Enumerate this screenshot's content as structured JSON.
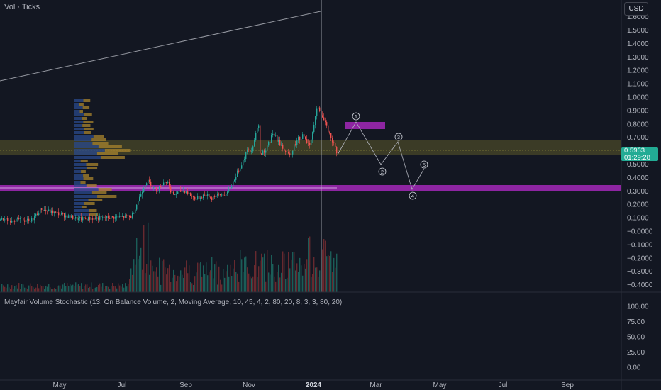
{
  "header": {
    "indicator_label": "Vol · Ticks",
    "currency": "USD"
  },
  "price_axis": {
    "labels": [
      "1.6000",
      "1.5000",
      "1.4000",
      "1.3000",
      "1.2000",
      "1.1000",
      "1.0000",
      "0.9000",
      "0.8000",
      "0.7000",
      "0.6000",
      "0.5000",
      "0.4000",
      "0.3000",
      "0.2000",
      "0.1000",
      "−0.0000",
      "−0.1000",
      "−0.2000",
      "−0.3000",
      "−0.4000"
    ],
    "values": [
      1.6,
      1.5,
      1.4,
      1.3,
      1.2,
      1.1,
      1.0,
      0.9,
      0.8,
      0.7,
      0.6,
      0.5,
      0.4,
      0.3,
      0.2,
      0.1,
      0,
      -0.1,
      -0.2,
      -0.3,
      -0.4
    ]
  },
  "current_price": {
    "value": "0.5963",
    "countdown": "01:29:28",
    "color": "#22ab94"
  },
  "indicator": {
    "label": "Mayfair Volume Stochastic (13, On Balance Volume, 2, Moving Average, 10, 45, 4, 2, 80, 20, 8, 3, 3, 80, 20)",
    "axis_labels": [
      "100.00",
      "75.00",
      "50.00",
      "25.00",
      "0.00"
    ],
    "axis_values": [
      100,
      75,
      50,
      25,
      0
    ]
  },
  "time_axis": {
    "labels": [
      "May",
      "Jul",
      "Sep",
      "Nov",
      "2024",
      "Mar",
      "May",
      "Jul",
      "Sep"
    ]
  },
  "wave_labels": [
    "1",
    "2",
    "3",
    "4",
    "5"
  ],
  "colors": {
    "up": "#26a69a",
    "down": "#ef5350",
    "zone_magenta": "#9c27b0",
    "zone_olive": "#5c5a2a"
  }
}
